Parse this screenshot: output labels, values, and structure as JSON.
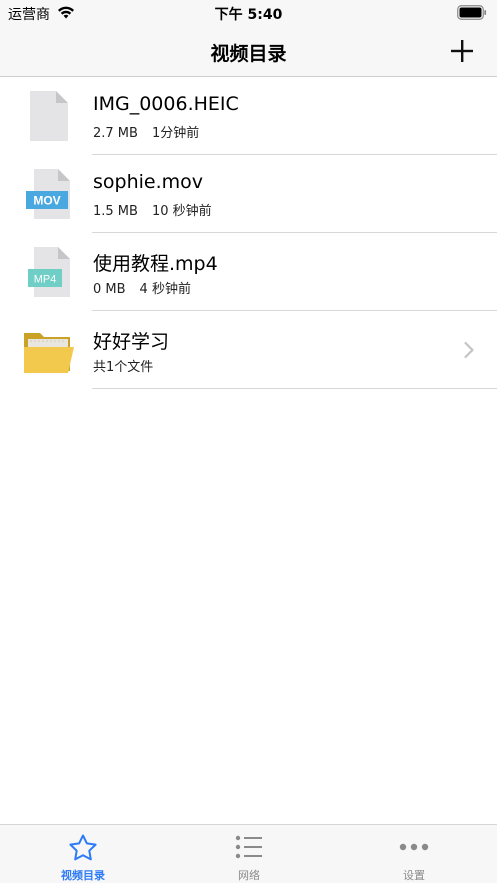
{
  "status_bar": {
    "carrier": "运营商",
    "time": "下午 5:40"
  },
  "nav": {
    "title": "视频目录",
    "add_icon": "plus-icon"
  },
  "files": [
    {
      "name": "IMG_0006.HEIC",
      "size": "2.7 MB",
      "time": "1分钟前",
      "icon": "generic-file-icon"
    },
    {
      "name": "sophie.mov",
      "size": "1.5 MB",
      "time": "10 秒钟前",
      "icon": "mov-file-icon",
      "badge": "MOV",
      "badge_color": "#4aa8e0"
    },
    {
      "name": "使用教程.mp4",
      "size": "0 MB",
      "time": "4 秒钟前",
      "icon": "mp4-file-icon",
      "badge": "MP4",
      "badge_color": "#6fcfc6"
    }
  ],
  "folder": {
    "name": "好好学习",
    "info": "共1个文件",
    "icon": "folder-icon",
    "color": "#f2c94c"
  },
  "tabs": [
    {
      "label": "视频目录",
      "icon": "star-icon",
      "active": true
    },
    {
      "label": "网络",
      "icon": "list-icon",
      "active": false
    },
    {
      "label": "设置",
      "icon": "more-icon",
      "active": false
    }
  ],
  "colors": {
    "accent": "#2d7bf6",
    "inactive": "#8a8a8a"
  }
}
